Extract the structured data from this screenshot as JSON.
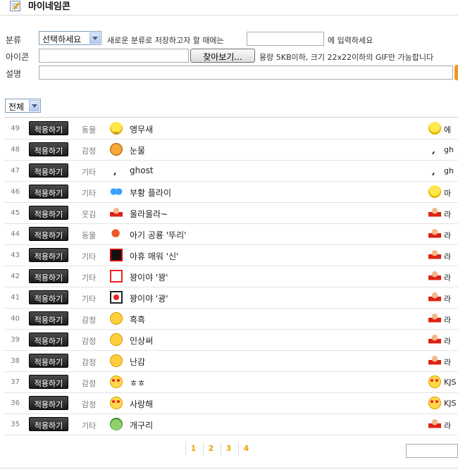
{
  "page": {
    "title": "마이네임콘"
  },
  "form": {
    "category_label": "분류",
    "category_select_value": "선택하세요",
    "new_category_prefix": "새로운 분류로 저장하고자 할 때에는",
    "new_category_value": "",
    "new_category_suffix": "에 입력하세요",
    "icon_label": "아이콘",
    "icon_file_value": "",
    "browse_button": "찾아보기...",
    "icon_hint": "용량 5KB이하, 크기 22x22이하의 GIF만 가능합니다",
    "desc_label": "설명",
    "desc_value": ""
  },
  "filter": {
    "selected": "전체"
  },
  "list": {
    "apply_label": "적용하기",
    "rows": [
      {
        "num": "49",
        "category": "동물",
        "name": "앵무새",
        "icon": "parrot-icon",
        "user_icon": "chick-icon",
        "user": "에"
      },
      {
        "num": "48",
        "category": "감정",
        "name": "눈물",
        "icon": "tears-icon",
        "user_icon": "ghost-icon",
        "user": "gh"
      },
      {
        "num": "47",
        "category": "기타",
        "name": "ghost",
        "icon": "ghost-icon",
        "user_icon": "ghost-icon",
        "user": "gh"
      },
      {
        "num": "46",
        "category": "기타",
        "name": "부황 플라이",
        "icon": "butterfly-icon",
        "user_icon": "chick-icon",
        "user": "마"
      },
      {
        "num": "45",
        "category": "웃김",
        "name": "울라울라~",
        "icon": "character-icon",
        "user_icon": "character-icon",
        "user": "라"
      },
      {
        "num": "44",
        "category": "동물",
        "name": "아기 공룡 '뚜리'",
        "icon": "dinosaur-icon",
        "user_icon": "character-icon",
        "user": "라"
      },
      {
        "num": "43",
        "category": "기타",
        "name": "아휴 매워 '신'",
        "icon": "spicy-sign-icon",
        "user_icon": "character-icon",
        "user": "라"
      },
      {
        "num": "42",
        "category": "기타",
        "name": "꽝이야 '꽝'",
        "icon": "gwang-stamp-icon",
        "user_icon": "character-icon",
        "user": "라"
      },
      {
        "num": "41",
        "category": "기타",
        "name": "꽝이야 '광'",
        "icon": "hwatu-card-icon",
        "user_icon": "character-icon",
        "user": "라"
      },
      {
        "num": "40",
        "category": "감정",
        "name": "흑흑",
        "icon": "crying-face-icon",
        "user_icon": "character-icon",
        "user": "라"
      },
      {
        "num": "39",
        "category": "감정",
        "name": "인상써",
        "icon": "frown-face-icon",
        "user_icon": "character-icon",
        "user": "라"
      },
      {
        "num": "38",
        "category": "감정",
        "name": "난감",
        "icon": "awkward-face-icon",
        "user_icon": "character-icon",
        "user": "라"
      },
      {
        "num": "37",
        "category": "감정",
        "name": "ㅎㅎ",
        "icon": "blush-face-icon",
        "user_icon": "heart-eyes-icon",
        "user": "KJS"
      },
      {
        "num": "36",
        "category": "감정",
        "name": "사랑해",
        "icon": "heart-eyes-icon",
        "user_icon": "heart-eyes-icon",
        "user": "KJS"
      },
      {
        "num": "35",
        "category": "기타",
        "name": "개구리",
        "icon": "frog-icon",
        "user_icon": "character-icon",
        "user": "라"
      }
    ]
  },
  "pagination": {
    "pages": [
      "1",
      "2",
      "3",
      "4"
    ]
  }
}
